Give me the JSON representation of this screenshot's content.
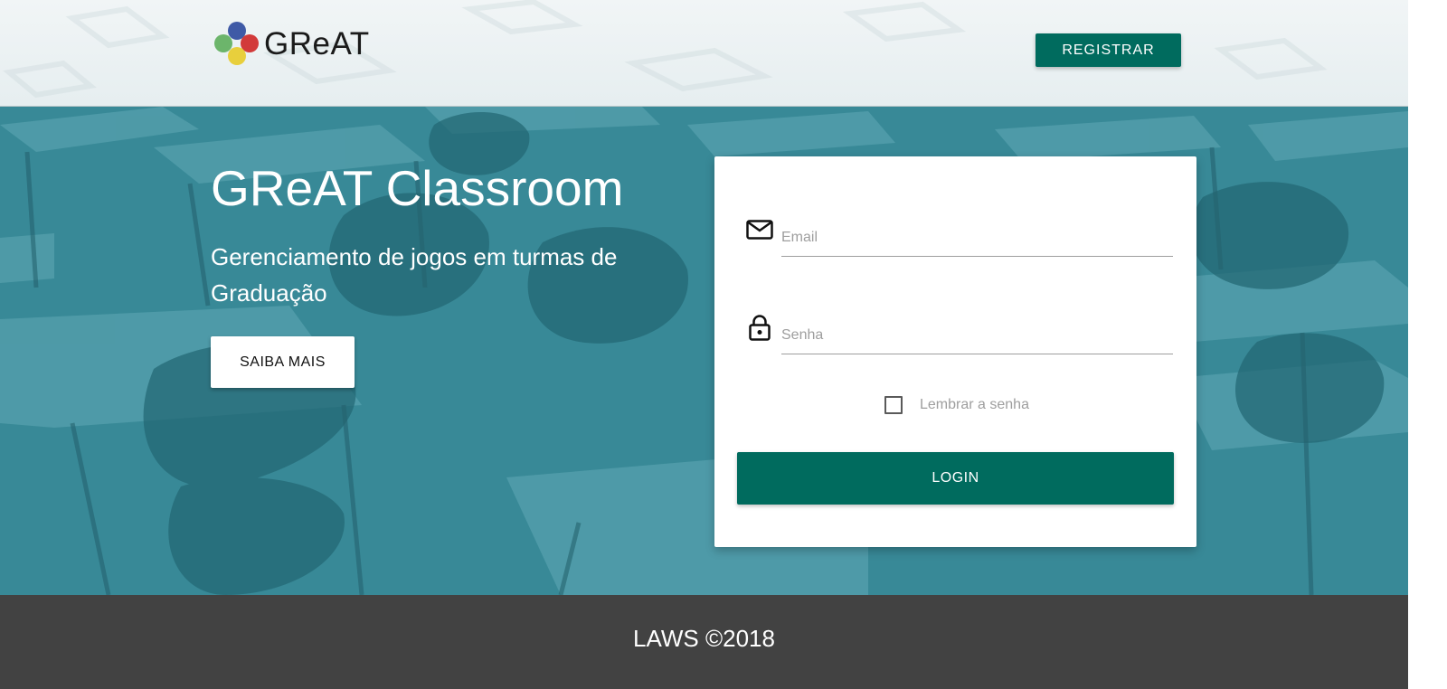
{
  "header": {
    "logo_text": "GReAT",
    "logo_colors": [
      "#3f5aa6",
      "#d23a3a",
      "#e8cf3c",
      "#6cb56b"
    ],
    "register_label": "REGISTRAR"
  },
  "hero": {
    "title": "GReAT Classroom",
    "subtitle": "Gerenciamento de jogos em turmas de Graduação",
    "learn_more_label": "SAIBA MAIS",
    "overlay_color": "#3f8f9c"
  },
  "login": {
    "email": {
      "icon": "mail-icon",
      "placeholder": "Email",
      "value": ""
    },
    "password": {
      "icon": "lock-icon",
      "placeholder": "Senha",
      "value": ""
    },
    "remember": {
      "label": "Lembrar a senha",
      "checked": false
    },
    "login_label": "LOGIN"
  },
  "theme": {
    "primary": "#006b5e",
    "footer_bg": "#424242"
  },
  "footer": {
    "text": "LAWS ©2018"
  }
}
